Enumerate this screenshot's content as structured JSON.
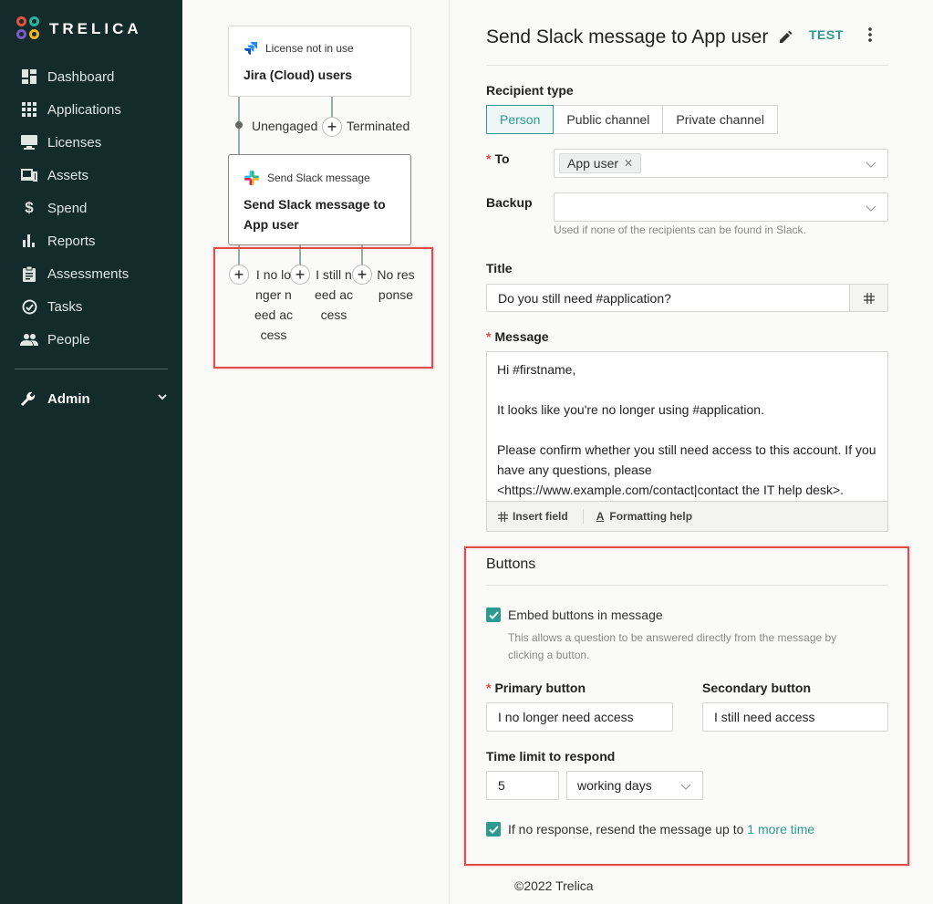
{
  "sidebar": {
    "brand": "TRELICA",
    "items": [
      {
        "label": "Dashboard",
        "icon": "dashboard-icon"
      },
      {
        "label": "Applications",
        "icon": "grid-icon"
      },
      {
        "label": "Licenses",
        "icon": "monitor-icon"
      },
      {
        "label": "Assets",
        "icon": "devices-icon"
      },
      {
        "label": "Spend",
        "icon": "dollar-icon"
      },
      {
        "label": "Reports",
        "icon": "bar-chart-icon"
      },
      {
        "label": "Assessments",
        "icon": "clipboard-icon"
      },
      {
        "label": "Tasks",
        "icon": "check-circle-icon"
      },
      {
        "label": "People",
        "icon": "people-icon"
      }
    ],
    "admin_label": "Admin"
  },
  "flow": {
    "trigger": {
      "type": "License not in use",
      "title": "Jira (Cloud) users"
    },
    "trigger_branches": [
      "Unengaged",
      "Terminated"
    ],
    "action": {
      "type": "Send Slack message",
      "title": "Send Slack message to App user"
    },
    "action_branches": [
      "I no longer need access",
      "I still need access",
      "No response"
    ]
  },
  "panel": {
    "title": "Send Slack message to App user",
    "test_label": "TEST",
    "recipient_type_label": "Recipient type",
    "recipient_types": [
      "Person",
      "Public channel",
      "Private channel"
    ],
    "selected_recipient_type": "Person",
    "to_label": "To",
    "to_tag": "App user",
    "backup_label": "Backup",
    "backup_hint": "Used if none of the recipients can be found in Slack.",
    "title_label": "Title",
    "title_value": "Do you still need #application?",
    "message_label": "Message",
    "message_lines": [
      "Hi #firstname,",
      "",
      "It looks like you're no longer using #application.",
      "",
      "Please confirm whether you still need access to this account. If you have any questions, please <https://www.example.com/contact|contact the IT help desk>."
    ],
    "insert_field_label": "Insert field",
    "formatting_help_label": "Formatting help",
    "buttons_section_title": "Buttons",
    "embed_label": "Embed buttons in message",
    "embed_hint": "This allows a question to be answered directly from the message by clicking a button.",
    "primary_button_label": "Primary button",
    "primary_button_value": "I no longer need access",
    "secondary_button_label": "Secondary button",
    "secondary_button_value": "I still need access",
    "time_limit_label": "Time limit to respond",
    "time_limit_value": "5",
    "time_unit": "working days",
    "resend_label": "If no response, resend the message up to",
    "resend_link": "1 more time"
  },
  "footer": "©2022 Trelica",
  "colors": {
    "sidebar_bg": "#142b2b",
    "accent": "#2c9a8f",
    "required": "#e04b4b",
    "highlight_box": "#e04b4b"
  }
}
